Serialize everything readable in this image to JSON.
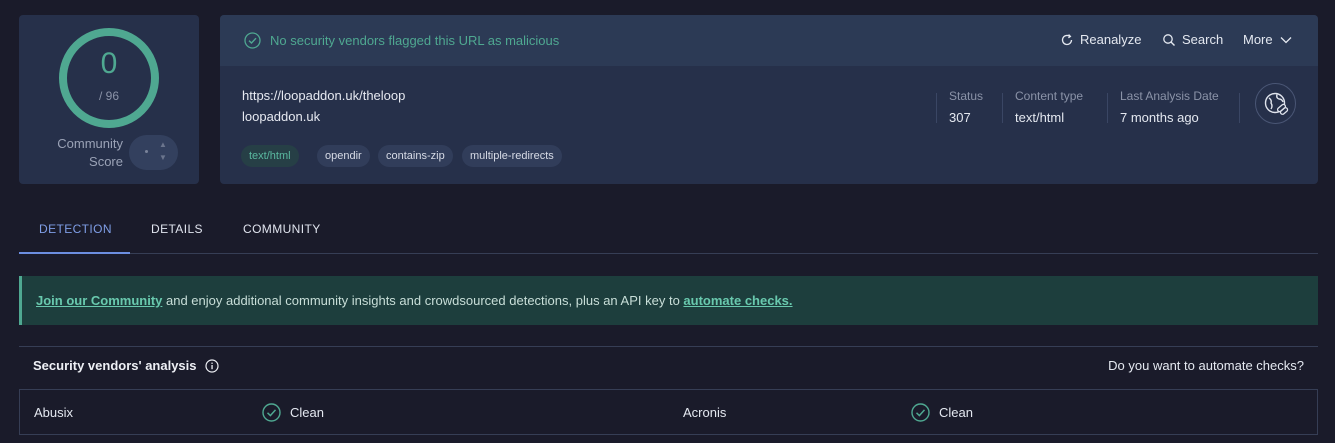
{
  "score": {
    "value": "0",
    "total": "/ 96",
    "community_label": "Community Score"
  },
  "banner": {
    "message": "No security vendors flagged this URL as malicious"
  },
  "toolbar": {
    "reanalyze": "Reanalyze",
    "search": "Search",
    "more": "More"
  },
  "target": {
    "url": "https://loopaddon.uk/theloop",
    "domain": "loopaddon.uk",
    "tags": [
      "text/html",
      "opendir",
      "contains-zip",
      "multiple-redirects"
    ]
  },
  "meta": {
    "status_label": "Status",
    "status_value": "307",
    "content_type_label": "Content type",
    "content_type_value": "text/html",
    "last_analysis_label": "Last Analysis Date",
    "last_analysis_value": "7 months ago"
  },
  "tabs": [
    {
      "label": "DETECTION",
      "active": true
    },
    {
      "label": "DETAILS",
      "active": false
    },
    {
      "label": "COMMUNITY",
      "active": false
    }
  ],
  "notice": {
    "link1": "Join our Community",
    "middle": " and enjoy additional community insights and crowdsourced detections, plus an API key to ",
    "link2": "automate checks."
  },
  "vendors": {
    "title": "Security vendors' analysis",
    "automate_question": "Do you want to automate checks?",
    "rows": [
      {
        "left_name": "Abusix",
        "left_result": "Clean",
        "right_name": "Acronis",
        "right_result": "Clean"
      }
    ]
  },
  "colors": {
    "clean": "#4fa891",
    "accent": "#6c8ee0",
    "background": "#1a1b2a",
    "card": "#26304a"
  },
  "icons": {
    "banner": "check-circle-icon",
    "reanalyze": "refresh-icon",
    "search": "search-icon",
    "more": "chevron-down-icon",
    "globe": "globe-link-icon",
    "info": "info-icon",
    "clean": "check-circle-icon"
  }
}
